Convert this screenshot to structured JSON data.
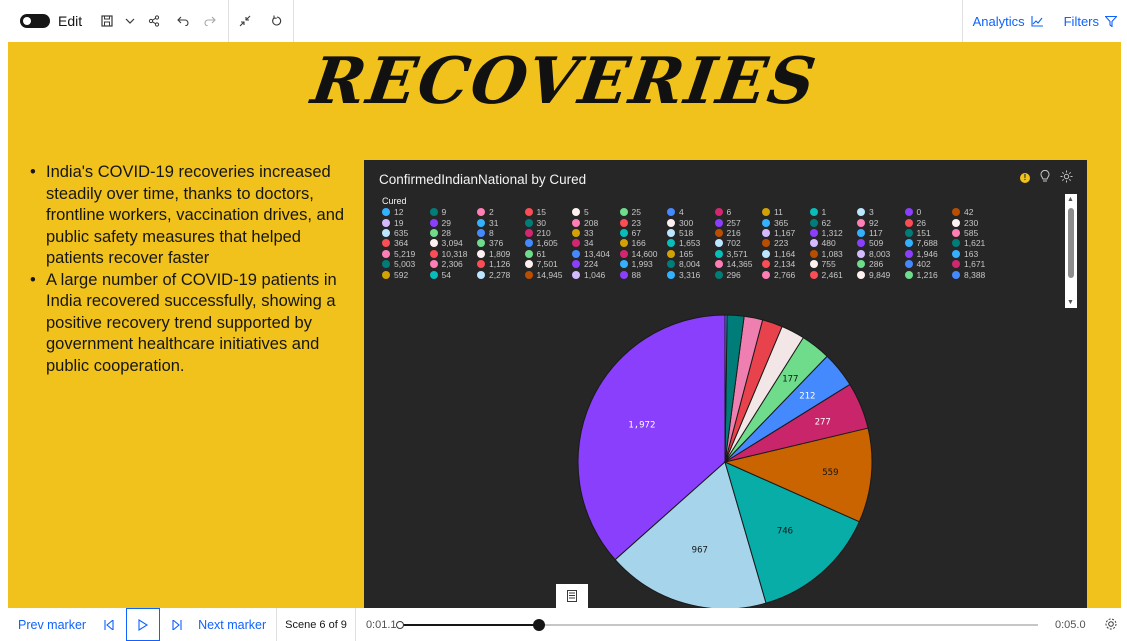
{
  "toolbar": {
    "edit_label": "Edit",
    "save_icon": "save-icon",
    "analytics_label": "Analytics",
    "filters_label": "Filters"
  },
  "slide": {
    "title": "RECOVERIES",
    "background_color": "#f1c21b",
    "bullets": [
      "India's COVID-19 recoveries increased steadily over time, thanks to doctors, frontline workers, vaccination drives, and public safety measures that helped patients recover faster",
      "A large number of COVID-19 patients in India recovered successfully, showing a positive recovery trend supported by government healthcare initiatives and public cooperation."
    ]
  },
  "chart": {
    "title": "ConfirmedIndianNational by Cured",
    "legend_title": "Cured",
    "legend_items": [
      {
        "label": "12",
        "color": "#33b1ff"
      },
      {
        "label": "9",
        "color": "#007d79"
      },
      {
        "label": "2",
        "color": "#ff7eb6"
      },
      {
        "label": "15",
        "color": "#fa4d56"
      },
      {
        "label": "5",
        "color": "#fff1f1"
      },
      {
        "label": "25",
        "color": "#6fdc8c"
      },
      {
        "label": "4",
        "color": "#4589ff"
      },
      {
        "label": "6",
        "color": "#d12771"
      },
      {
        "label": "11",
        "color": "#d2a106"
      },
      {
        "label": "1",
        "color": "#08bdba"
      },
      {
        "label": "3",
        "color": "#bae6ff"
      },
      {
        "label": "0",
        "color": "#8a3ffc"
      },
      {
        "label": "42",
        "color": "#ba4e00"
      },
      {
        "label": "19",
        "color": "#d4bbff"
      },
      {
        "label": "29",
        "color": "#8a3ffc"
      },
      {
        "label": "31",
        "color": "#33b1ff"
      },
      {
        "label": "30",
        "color": "#007d79"
      },
      {
        "label": "208",
        "color": "#ff7eb6"
      },
      {
        "label": "23",
        "color": "#fa4d56"
      },
      {
        "label": "300",
        "color": "#fff1f1"
      },
      {
        "label": "257",
        "color": "#8a3ffc"
      },
      {
        "label": "365",
        "color": "#33b1ff"
      },
      {
        "label": "62",
        "color": "#007d79"
      },
      {
        "label": "92",
        "color": "#ff7eb6"
      },
      {
        "label": "26",
        "color": "#fa4d56"
      },
      {
        "label": "230",
        "color": "#fff1f1"
      },
      {
        "label": "635",
        "color": "#bae6ff"
      },
      {
        "label": "28",
        "color": "#6fdc8c"
      },
      {
        "label": "8",
        "color": "#4589ff"
      },
      {
        "label": "210",
        "color": "#d12771"
      },
      {
        "label": "33",
        "color": "#d2a106"
      },
      {
        "label": "67",
        "color": "#08bdba"
      },
      {
        "label": "518",
        "color": "#bae6ff"
      },
      {
        "label": "216",
        "color": "#ba4e00"
      },
      {
        "label": "1,167",
        "color": "#d4bbff"
      },
      {
        "label": "1,312",
        "color": "#8a3ffc"
      },
      {
        "label": "117",
        "color": "#33b1ff"
      },
      {
        "label": "151",
        "color": "#007d79"
      },
      {
        "label": "585",
        "color": "#ff7eb6"
      },
      {
        "label": "364",
        "color": "#fa4d56"
      },
      {
        "label": "3,094",
        "color": "#fff1f1"
      },
      {
        "label": "376",
        "color": "#6fdc8c"
      },
      {
        "label": "1,605",
        "color": "#4589ff"
      },
      {
        "label": "34",
        "color": "#d12771"
      },
      {
        "label": "166",
        "color": "#d2a106"
      },
      {
        "label": "1,653",
        "color": "#08bdba"
      },
      {
        "label": "702",
        "color": "#bae6ff"
      },
      {
        "label": "223",
        "color": "#ba4e00"
      },
      {
        "label": "480",
        "color": "#d4bbff"
      },
      {
        "label": "509",
        "color": "#8a3ffc"
      },
      {
        "label": "7,688",
        "color": "#33b1ff"
      },
      {
        "label": "1,621",
        "color": "#007d79"
      },
      {
        "label": "5,219",
        "color": "#ff7eb6"
      },
      {
        "label": "10,318",
        "color": "#fa4d56"
      },
      {
        "label": "1,809",
        "color": "#fff1f1"
      },
      {
        "label": "61",
        "color": "#6fdc8c"
      },
      {
        "label": "13,404",
        "color": "#4589ff"
      },
      {
        "label": "14,600",
        "color": "#d12771"
      },
      {
        "label": "165",
        "color": "#d2a106"
      },
      {
        "label": "3,571",
        "color": "#08bdba"
      },
      {
        "label": "1,164",
        "color": "#bae6ff"
      },
      {
        "label": "1,083",
        "color": "#ba4e00"
      },
      {
        "label": "8,003",
        "color": "#d4bbff"
      },
      {
        "label": "1,946",
        "color": "#8a3ffc"
      },
      {
        "label": "163",
        "color": "#33b1ff"
      },
      {
        "label": "5,003",
        "color": "#007d79"
      },
      {
        "label": "2,306",
        "color": "#ff7eb6"
      },
      {
        "label": "1,126",
        "color": "#fa4d56"
      },
      {
        "label": "7,501",
        "color": "#fff1f1"
      },
      {
        "label": "224",
        "color": "#8a3ffc"
      },
      {
        "label": "1,993",
        "color": "#33b1ff"
      },
      {
        "label": "8,004",
        "color": "#007d79"
      },
      {
        "label": "14,365",
        "color": "#ff7eb6"
      },
      {
        "label": "2,134",
        "color": "#fa4d56"
      },
      {
        "label": "755",
        "color": "#fff1f1"
      },
      {
        "label": "286",
        "color": "#6fdc8c"
      },
      {
        "label": "402",
        "color": "#4589ff"
      },
      {
        "label": "1,671",
        "color": "#d12771"
      },
      {
        "label": "592",
        "color": "#d2a106"
      },
      {
        "label": "54",
        "color": "#08bdba"
      },
      {
        "label": "2,278",
        "color": "#bae6ff"
      },
      {
        "label": "14,945",
        "color": "#ba4e00"
      },
      {
        "label": "1,046",
        "color": "#d4bbff"
      },
      {
        "label": "88",
        "color": "#8a3ffc"
      },
      {
        "label": "3,316",
        "color": "#33b1ff"
      },
      {
        "label": "296",
        "color": "#007d79"
      },
      {
        "label": "2,766",
        "color": "#ff7eb6"
      },
      {
        "label": "2,461",
        "color": "#fa4d56"
      },
      {
        "label": "9,849",
        "color": "#fff1f1"
      },
      {
        "label": "1,216",
        "color": "#6fdc8c"
      },
      {
        "label": "8,388",
        "color": "#4589ff"
      }
    ]
  },
  "chart_data": {
    "type": "pie",
    "title": "ConfirmedIndianNational by Cured",
    "legend_title": "Cured",
    "slices": [
      {
        "value": 1972,
        "label": "1,972",
        "color": "#8a3ffc"
      },
      {
        "value": 967,
        "label": "967",
        "color": "#a6d4ea"
      },
      {
        "value": 746,
        "label": "746",
        "color": "#08ada8"
      },
      {
        "value": 559,
        "label": "559",
        "color": "#c96400"
      },
      {
        "value": 277,
        "label": "277",
        "color": "#c8256b"
      },
      {
        "value": 212,
        "label": "212",
        "color": "#4589ff"
      },
      {
        "value": 177,
        "label": "177",
        "color": "#6fdc8c"
      },
      {
        "value": 140,
        "label": "",
        "color": "#f2e6e6"
      },
      {
        "value": 120,
        "label": "",
        "color": "#e8424d"
      },
      {
        "value": 110,
        "label": "",
        "color": "#ef7fb0"
      },
      {
        "value": 100,
        "label": "",
        "color": "#007d79"
      },
      {
        "value": 12,
        "label": "",
        "color": "#4589ff"
      }
    ]
  },
  "playback": {
    "prev_marker": "Prev marker",
    "next_marker": "Next marker",
    "scene": "Scene 6 of 9",
    "current_time": "0:01.1",
    "end_time": "0:05.0",
    "progress": 0.22
  }
}
